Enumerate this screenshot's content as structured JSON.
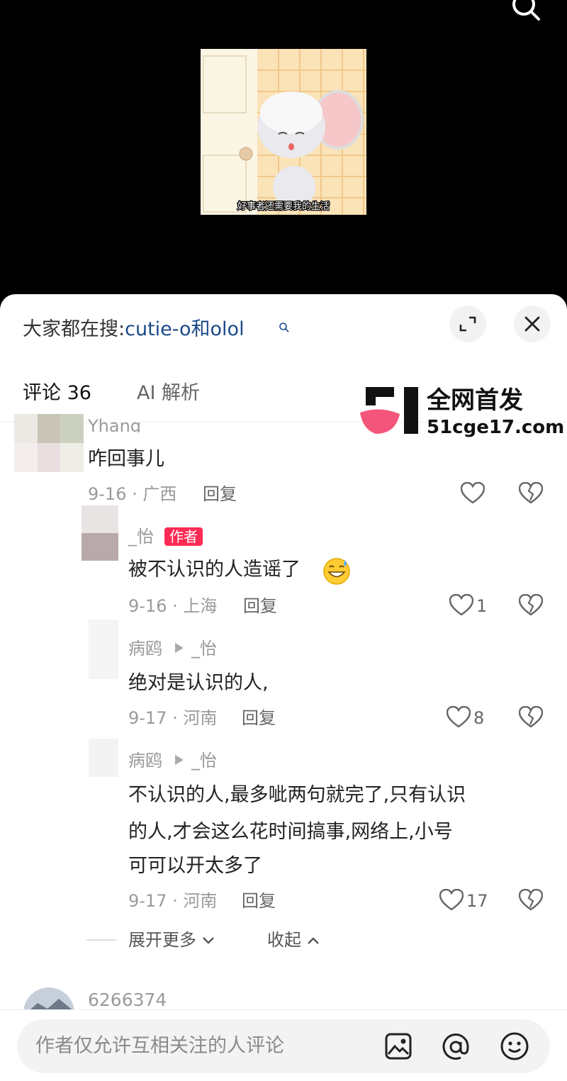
{
  "video": {
    "subtitle": "好事者还需要我的生活"
  },
  "trending": {
    "prefix": "大家都在搜:",
    "query": "cutie-o和olol"
  },
  "tabs": [
    "评论 36",
    "AI 解析"
  ],
  "watermark": {
    "title": "全网首发",
    "site": "51cge17.com"
  },
  "comments": [
    {
      "name": "Yhang",
      "text": "咋回事儿",
      "meta": "9-16 · 广西",
      "reply": "回复",
      "likes": ""
    },
    {
      "name": "_怡",
      "badge": "作者",
      "text": "被不认识的人造谣了",
      "meta": "9-16 · 上海",
      "reply": "回复",
      "likes": "1"
    },
    {
      "name": "病鸥",
      "to": "_怡",
      "text": "绝对是认识的人,",
      "meta": "9-17 · 河南",
      "reply": "回复",
      "likes": "8"
    },
    {
      "name": "病鸥",
      "to": "_怡",
      "text_lines": [
        "不认识的人,最多呲两句就完了,只有认识",
        "的人,才会这么花时间搞事,网络上,小号",
        "可可以开太多了"
      ],
      "meta": "9-17 · 河南",
      "reply": "回复",
      "likes": "17"
    }
  ],
  "thread_controls": {
    "expand": "展开更多",
    "collapse": "收起"
  },
  "next_comment": {
    "name": "6266374"
  },
  "input": {
    "placeholder": "作者仅允许互相关注的人评论"
  },
  "colors": {
    "brand_pink": "#fe2c55",
    "link_blue": "#1b4a8a"
  }
}
